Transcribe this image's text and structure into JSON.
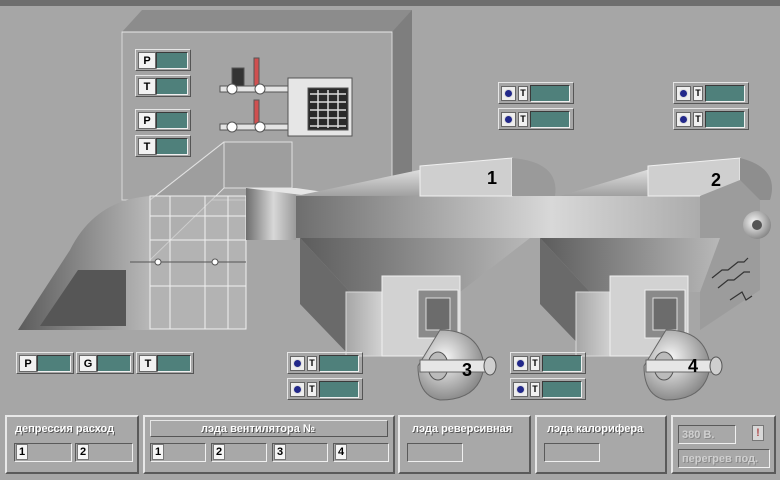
{
  "sensors": {
    "box_p1": "P",
    "box_t1": "T",
    "box_p2": "P",
    "box_t2": "T",
    "bottom_p": "P",
    "bottom_g": "G",
    "bottom_t": "T",
    "fan_t": "T"
  },
  "fans": {
    "f1": "1",
    "f2": "2",
    "f3": "3",
    "f4": "4"
  },
  "panels": {
    "depression": {
      "title": "депрессия расход",
      "slots": [
        "1",
        "2"
      ]
    },
    "fan_state": {
      "title": "лэда вентилятора №",
      "slots": [
        "1",
        "2",
        "3",
        "4"
      ]
    },
    "reverse": {
      "title": "лэда реверсивная"
    },
    "heater": {
      "title": "лэда калорифера"
    },
    "power": {
      "voltage": "380 В.",
      "alarm": "!",
      "overheat": "перегрев под."
    }
  },
  "colors": {
    "background": "#a6a6a6",
    "value_fill": "#4f807b"
  }
}
